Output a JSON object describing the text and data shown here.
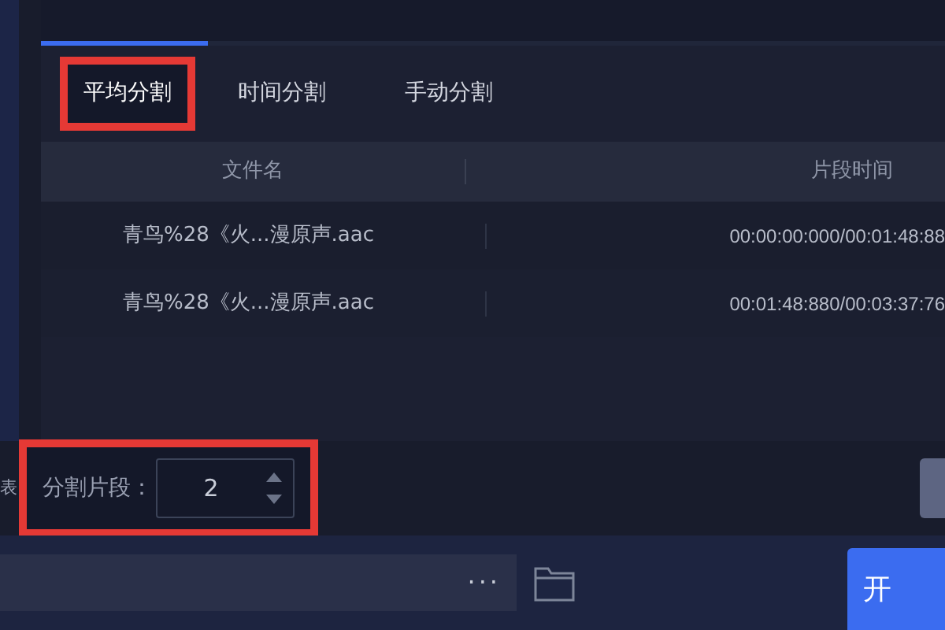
{
  "tabs": [
    {
      "label": "平均分割",
      "selected": true
    },
    {
      "label": "时间分割",
      "selected": false
    },
    {
      "label": "手动分割",
      "selected": false
    }
  ],
  "table": {
    "columns": [
      "文件名",
      "片段时间"
    ],
    "rows": [
      {
        "file": "青鸟%28《火...漫原声.aac",
        "time": "00:00:00:000/00:01:48:88"
      },
      {
        "file": "青鸟%28《火...漫原声.aac",
        "time": "00:01:48:880/00:03:37:76"
      }
    ]
  },
  "left_edge_label": "表",
  "segments": {
    "label": "分割片段：",
    "value": "2"
  },
  "output_path": {
    "browse": "···"
  },
  "start_button": "开"
}
